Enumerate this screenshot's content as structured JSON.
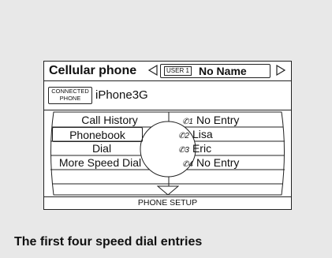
{
  "screen": {
    "title": "Cellular phone",
    "user_badge": "USER 1",
    "user_name": "No Name",
    "connection_badge_line1": "CONNECTED",
    "connection_badge_line2": "PHONE",
    "device_name": "iPhone3G"
  },
  "menu": {
    "items": [
      {
        "label": "Call History",
        "selected": false
      },
      {
        "label": "Phonebook",
        "selected": true
      },
      {
        "label": "Dial",
        "selected": false
      },
      {
        "label": "More Speed Dial",
        "selected": false
      }
    ]
  },
  "speed_dial": [
    {
      "slot": "1",
      "label": "No Entry"
    },
    {
      "slot": "2",
      "label": "Lisa"
    },
    {
      "slot": "3",
      "label": "Eric"
    },
    {
      "slot": "4",
      "label": "No Entry"
    }
  ],
  "footer": {
    "label": "PHONE SETUP"
  },
  "caption": "The first four speed dial entries",
  "icons": {
    "left_arrow": "triangle-left-icon",
    "right_arrow": "triangle-right-icon",
    "down_arrow": "triangle-down-icon",
    "speed_dial_marker": "handset-icon"
  }
}
